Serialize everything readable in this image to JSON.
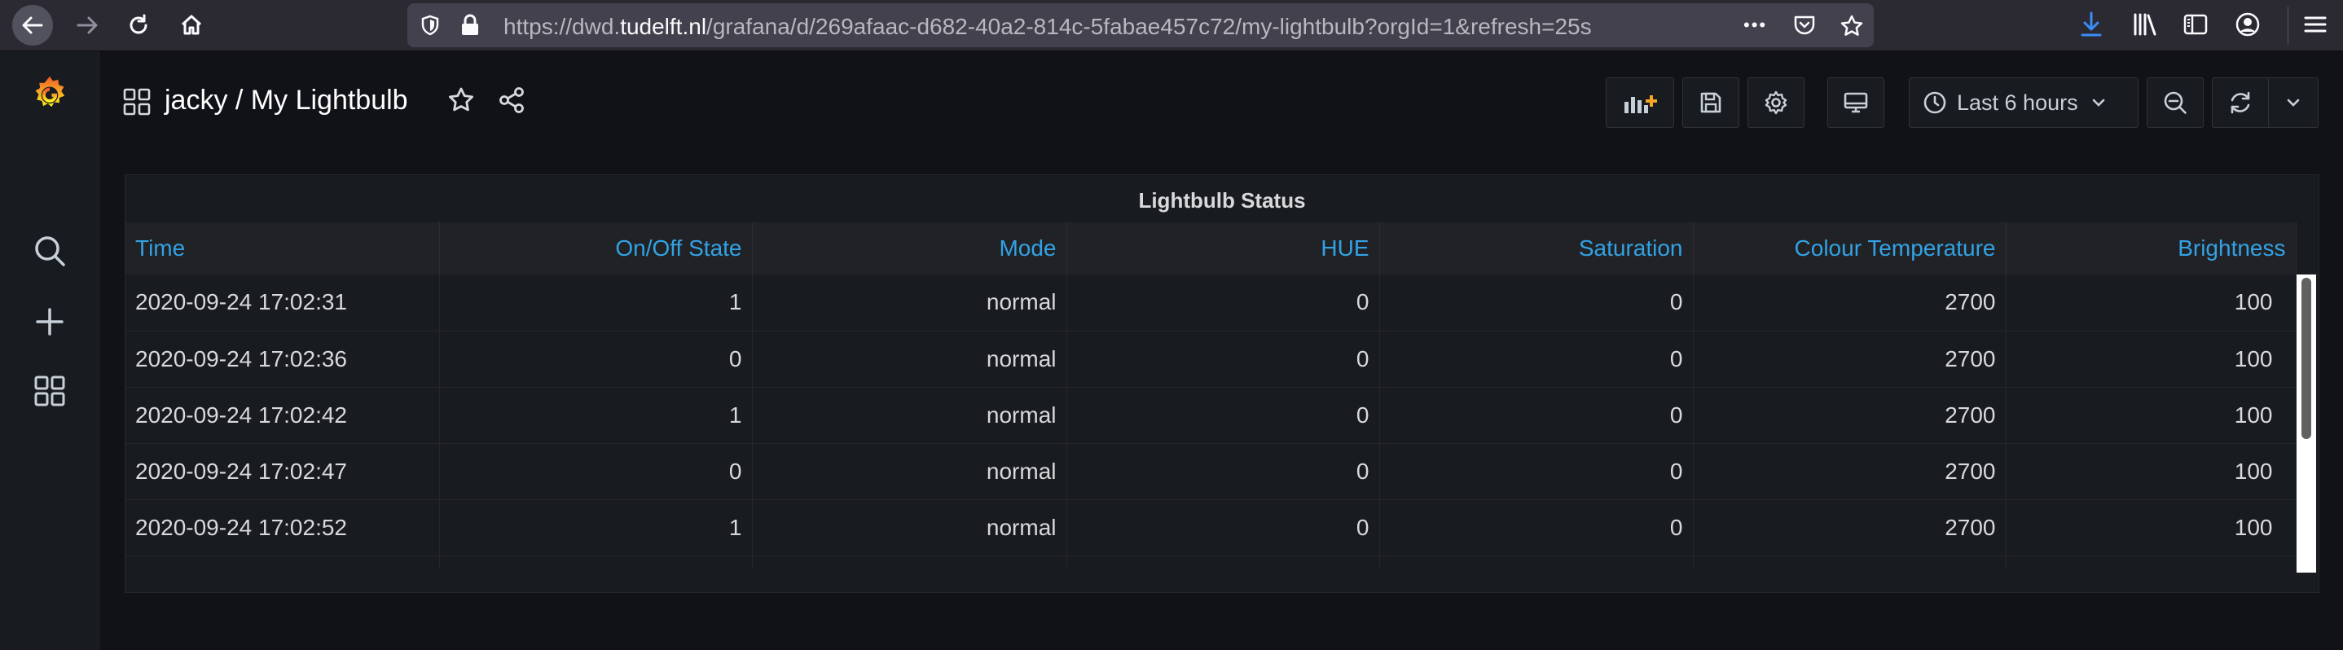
{
  "browser": {
    "url_prefix": "https://dwd.",
    "url_domain": "tudelft.nl",
    "url_path": "/grafana/d/269afaac-d682-40a2-814c-5fabae457c72/my-lightbulb?orgId=1&refresh=25s",
    "url_more": "•••"
  },
  "dashboard": {
    "title": "jacky / My Lightbulb",
    "time_range": "Last 6 hours"
  },
  "panel": {
    "title": "Lightbulb Status",
    "columns": [
      "Time",
      "On/Off State",
      "Mode",
      "HUE",
      "Saturation",
      "Colour Temperature",
      "Brightness"
    ],
    "rows": [
      [
        "2020-09-24 17:02:31",
        "1",
        "normal",
        "0",
        "0",
        "2700",
        "100"
      ],
      [
        "2020-09-24 17:02:36",
        "0",
        "normal",
        "0",
        "0",
        "2700",
        "100"
      ],
      [
        "2020-09-24 17:02:42",
        "1",
        "normal",
        "0",
        "0",
        "2700",
        "100"
      ],
      [
        "2020-09-24 17:02:47",
        "0",
        "normal",
        "0",
        "0",
        "2700",
        "100"
      ],
      [
        "2020-09-24 17:02:52",
        "1",
        "normal",
        "0",
        "0",
        "2700",
        "100"
      ]
    ]
  },
  "colors": {
    "accent": "#33a2e5",
    "grafana_logo": "#f46800",
    "download": "#3a8df6"
  },
  "icons": [
    "back-icon",
    "forward-icon",
    "reload-icon",
    "home-icon",
    "shield-icon",
    "lock-icon",
    "pocket-icon",
    "star-icon",
    "download-icon",
    "library-icon",
    "sidebar-icon",
    "account-icon",
    "hamburger-icon",
    "grafana-logo-icon",
    "search-icon",
    "plus-icon",
    "dashboards-icon",
    "share-icon",
    "add-panel-icon",
    "save-icon",
    "settings-icon",
    "tv-icon",
    "clock-icon",
    "chevron-down-icon",
    "zoom-out-icon",
    "refresh-icon"
  ]
}
